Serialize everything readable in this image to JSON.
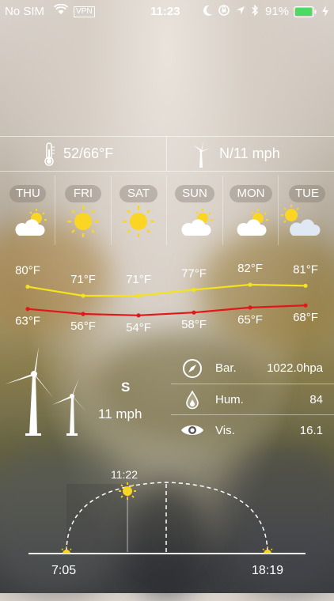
{
  "status_bar": {
    "carrier": "No SIM",
    "vpn": "VPN",
    "time": "11:23",
    "battery_pct": "91%",
    "battery_level": 0.91
  },
  "summary": {
    "temp_range": "52/66°F",
    "wind": "N/11 mph"
  },
  "days": [
    {
      "label": "THU",
      "icon": "cloud-sun-icon"
    },
    {
      "label": "FRI",
      "icon": "sun-icon"
    },
    {
      "label": "SAT",
      "icon": "sun-icon"
    },
    {
      "label": "SUN",
      "icon": "cloud-sun-icon"
    },
    {
      "label": "MON",
      "icon": "cloud-sun-icon"
    },
    {
      "label": "TUE",
      "icon": "sun-cloud-icon"
    }
  ],
  "chart_data": {
    "type": "line",
    "categories": [
      "THU",
      "FRI",
      "SAT",
      "SUN",
      "MON",
      "TUE"
    ],
    "series": [
      {
        "values": [
          80,
          71,
          71,
          77,
          82,
          81
        ],
        "labels": [
          "80°F",
          "71°F",
          "71°F",
          "77°F",
          "82°F",
          "81°F"
        ],
        "color": "#f4e31c"
      },
      {
        "values": [
          63,
          56,
          54,
          58,
          65,
          68
        ],
        "labels": [
          "63°F",
          "56°F",
          "54°F",
          "58°F",
          "65°F",
          "68°F"
        ],
        "color": "#e3161b"
      }
    ]
  },
  "wind_panel": {
    "direction": "S",
    "speed": "11 mph"
  },
  "details": {
    "bar_label": "Bar.",
    "bar_value": "1022.0hpa",
    "hum_label": "Hum.",
    "hum_value": "84",
    "vis_label": "Vis.",
    "vis_value": "16.1"
  },
  "sun": {
    "current_time": "11:22",
    "sunrise": "7:05",
    "sunset": "18:19"
  },
  "colors": {
    "high_line": "#f4e31c",
    "low_line": "#e3161b",
    "sun": "#fbd524"
  }
}
